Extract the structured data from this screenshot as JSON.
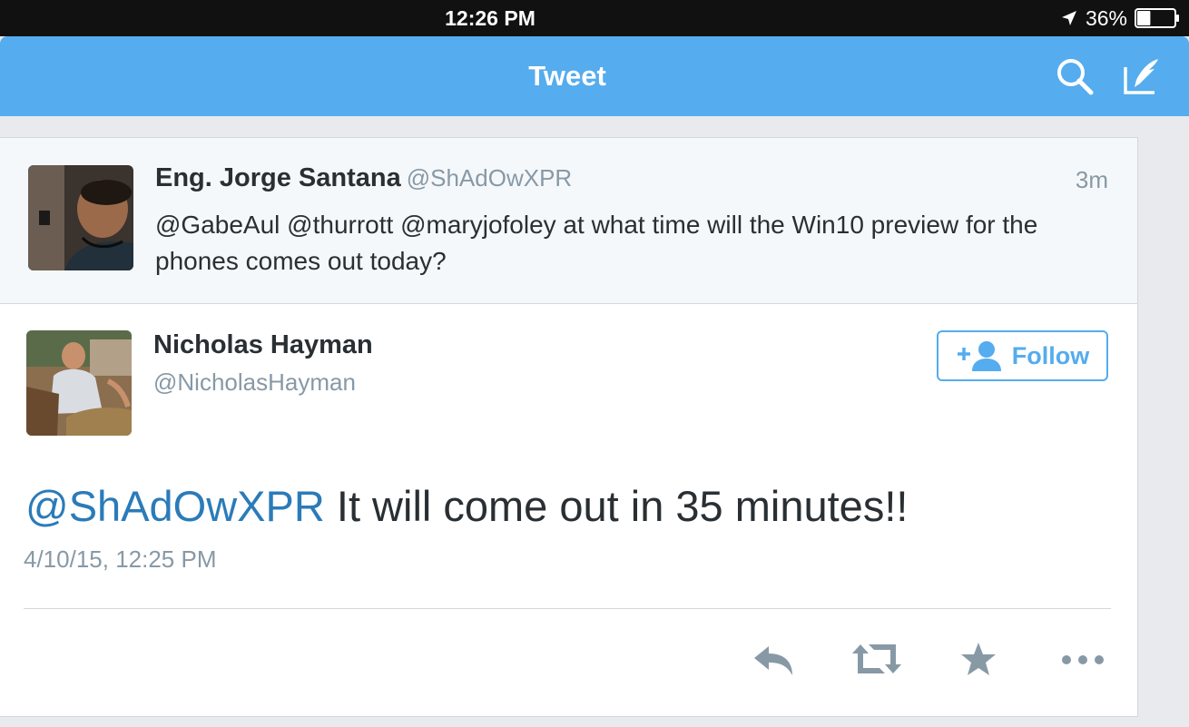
{
  "status_bar": {
    "time": "12:26 PM",
    "battery_percent": "36%",
    "battery_level": 0.36
  },
  "nav": {
    "title": "Tweet",
    "icons": [
      "search-icon",
      "compose-icon"
    ]
  },
  "parent_tweet": {
    "name": "Eng. Jorge Santana",
    "handle": "@ShAdOwXPR",
    "time": "3m",
    "text": "@GabeAul @thurrott @maryjofoley at what time will the Win10 preview for the phones comes out today?"
  },
  "tweet": {
    "author_name": "Nicholas Hayman",
    "author_handle": "@NicholasHayman",
    "follow_label": "Follow",
    "mention": "@ShAdOwXPR",
    "text": " It will come out in 35 minutes!!",
    "date": "4/10/15, 12:25 PM"
  },
  "actions": [
    "reply-icon",
    "retweet-icon",
    "favorite-icon",
    "more-icon"
  ],
  "colors": {
    "accent": "#55acee",
    "link": "#2b7bb9",
    "text": "#292f33",
    "muted": "#8899a6",
    "action_icon": "#8899a6"
  }
}
